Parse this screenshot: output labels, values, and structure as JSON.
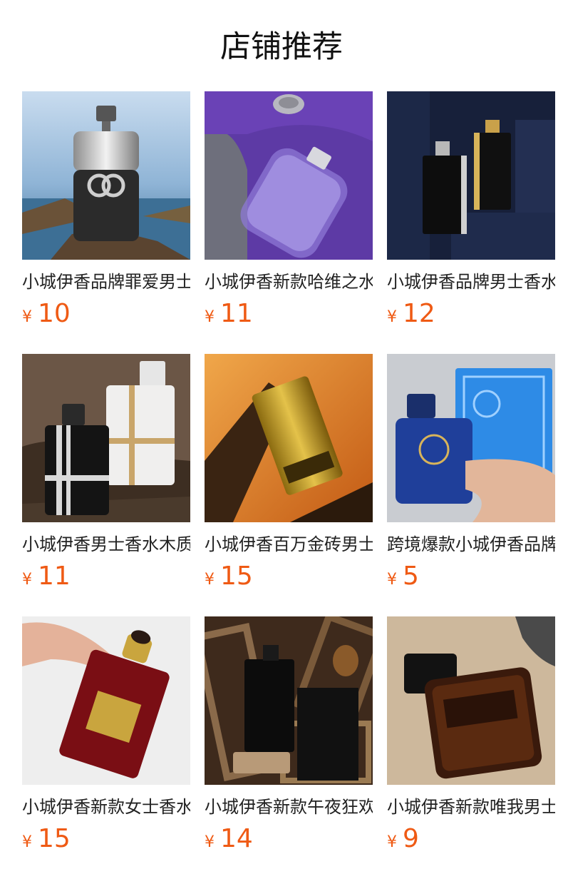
{
  "header": {
    "title": "店铺推荐"
  },
  "currency_symbol": "¥",
  "accent_color": "#ef5a14",
  "products": [
    {
      "name": "小城伊香品牌罪爱男士香水",
      "price": "10",
      "image": "silver-black-bottle-on-rock-by-sea"
    },
    {
      "name": "小城伊香新款哈维之水香水",
      "price": "11",
      "image": "clear-jean-miss-bottle-on-purple"
    },
    {
      "name": "小城伊香品牌男士香水",
      "price": "12",
      "image": "eternal-royal-bottles-on-navy"
    },
    {
      "name": "小城伊香男士香水木质调",
      "price": "11",
      "image": "black-white-striped-bottles-on-driftwood"
    },
    {
      "name": "小城伊香百万金砖男士香水",
      "price": "15",
      "image": "gold-bar-bottle-on-wood"
    },
    {
      "name": "跨境爆款小城伊香品牌香水",
      "price": "5",
      "image": "blue-jean-miss-bottle-and-box-in-hand"
    },
    {
      "name": "小城伊香新款女士香水",
      "price": "15",
      "image": "red-bottle-with-gold-cap-in-hand"
    },
    {
      "name": "小城伊香新款午夜狂欢香水",
      "price": "14",
      "image": "black-jean-miss-box-on-wood-frames"
    },
    {
      "name": "小城伊香新款唯我男士香水",
      "price": "9",
      "image": "dolce-gabbana-the-one-bottle"
    }
  ]
}
